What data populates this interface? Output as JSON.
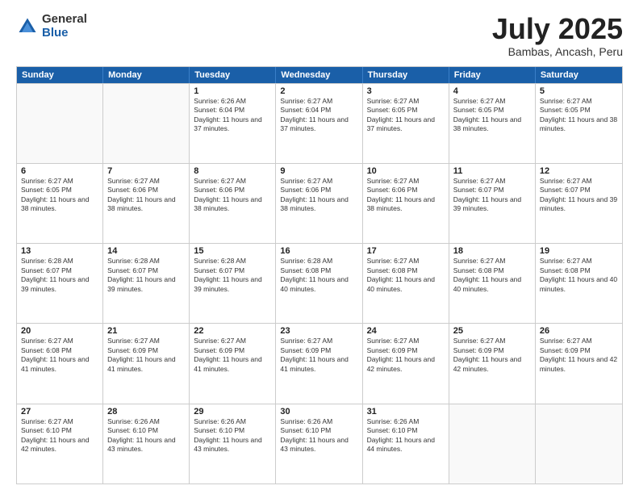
{
  "logo": {
    "general": "General",
    "blue": "Blue"
  },
  "title": "July 2025",
  "subtitle": "Bambas, Ancash, Peru",
  "days": [
    "Sunday",
    "Monday",
    "Tuesday",
    "Wednesday",
    "Thursday",
    "Friday",
    "Saturday"
  ],
  "weeks": [
    [
      {
        "day": "",
        "content": ""
      },
      {
        "day": "",
        "content": ""
      },
      {
        "day": "1",
        "content": "Sunrise: 6:26 AM\nSunset: 6:04 PM\nDaylight: 11 hours and 37 minutes."
      },
      {
        "day": "2",
        "content": "Sunrise: 6:27 AM\nSunset: 6:04 PM\nDaylight: 11 hours and 37 minutes."
      },
      {
        "day": "3",
        "content": "Sunrise: 6:27 AM\nSunset: 6:05 PM\nDaylight: 11 hours and 37 minutes."
      },
      {
        "day": "4",
        "content": "Sunrise: 6:27 AM\nSunset: 6:05 PM\nDaylight: 11 hours and 38 minutes."
      },
      {
        "day": "5",
        "content": "Sunrise: 6:27 AM\nSunset: 6:05 PM\nDaylight: 11 hours and 38 minutes."
      }
    ],
    [
      {
        "day": "6",
        "content": "Sunrise: 6:27 AM\nSunset: 6:05 PM\nDaylight: 11 hours and 38 minutes."
      },
      {
        "day": "7",
        "content": "Sunrise: 6:27 AM\nSunset: 6:06 PM\nDaylight: 11 hours and 38 minutes."
      },
      {
        "day": "8",
        "content": "Sunrise: 6:27 AM\nSunset: 6:06 PM\nDaylight: 11 hours and 38 minutes."
      },
      {
        "day": "9",
        "content": "Sunrise: 6:27 AM\nSunset: 6:06 PM\nDaylight: 11 hours and 38 minutes."
      },
      {
        "day": "10",
        "content": "Sunrise: 6:27 AM\nSunset: 6:06 PM\nDaylight: 11 hours and 38 minutes."
      },
      {
        "day": "11",
        "content": "Sunrise: 6:27 AM\nSunset: 6:07 PM\nDaylight: 11 hours and 39 minutes."
      },
      {
        "day": "12",
        "content": "Sunrise: 6:27 AM\nSunset: 6:07 PM\nDaylight: 11 hours and 39 minutes."
      }
    ],
    [
      {
        "day": "13",
        "content": "Sunrise: 6:28 AM\nSunset: 6:07 PM\nDaylight: 11 hours and 39 minutes."
      },
      {
        "day": "14",
        "content": "Sunrise: 6:28 AM\nSunset: 6:07 PM\nDaylight: 11 hours and 39 minutes."
      },
      {
        "day": "15",
        "content": "Sunrise: 6:28 AM\nSunset: 6:07 PM\nDaylight: 11 hours and 39 minutes."
      },
      {
        "day": "16",
        "content": "Sunrise: 6:28 AM\nSunset: 6:08 PM\nDaylight: 11 hours and 40 minutes."
      },
      {
        "day": "17",
        "content": "Sunrise: 6:27 AM\nSunset: 6:08 PM\nDaylight: 11 hours and 40 minutes."
      },
      {
        "day": "18",
        "content": "Sunrise: 6:27 AM\nSunset: 6:08 PM\nDaylight: 11 hours and 40 minutes."
      },
      {
        "day": "19",
        "content": "Sunrise: 6:27 AM\nSunset: 6:08 PM\nDaylight: 11 hours and 40 minutes."
      }
    ],
    [
      {
        "day": "20",
        "content": "Sunrise: 6:27 AM\nSunset: 6:08 PM\nDaylight: 11 hours and 41 minutes."
      },
      {
        "day": "21",
        "content": "Sunrise: 6:27 AM\nSunset: 6:09 PM\nDaylight: 11 hours and 41 minutes."
      },
      {
        "day": "22",
        "content": "Sunrise: 6:27 AM\nSunset: 6:09 PM\nDaylight: 11 hours and 41 minutes."
      },
      {
        "day": "23",
        "content": "Sunrise: 6:27 AM\nSunset: 6:09 PM\nDaylight: 11 hours and 41 minutes."
      },
      {
        "day": "24",
        "content": "Sunrise: 6:27 AM\nSunset: 6:09 PM\nDaylight: 11 hours and 42 minutes."
      },
      {
        "day": "25",
        "content": "Sunrise: 6:27 AM\nSunset: 6:09 PM\nDaylight: 11 hours and 42 minutes."
      },
      {
        "day": "26",
        "content": "Sunrise: 6:27 AM\nSunset: 6:09 PM\nDaylight: 11 hours and 42 minutes."
      }
    ],
    [
      {
        "day": "27",
        "content": "Sunrise: 6:27 AM\nSunset: 6:10 PM\nDaylight: 11 hours and 42 minutes."
      },
      {
        "day": "28",
        "content": "Sunrise: 6:26 AM\nSunset: 6:10 PM\nDaylight: 11 hours and 43 minutes."
      },
      {
        "day": "29",
        "content": "Sunrise: 6:26 AM\nSunset: 6:10 PM\nDaylight: 11 hours and 43 minutes."
      },
      {
        "day": "30",
        "content": "Sunrise: 6:26 AM\nSunset: 6:10 PM\nDaylight: 11 hours and 43 minutes."
      },
      {
        "day": "31",
        "content": "Sunrise: 6:26 AM\nSunset: 6:10 PM\nDaylight: 11 hours and 44 minutes."
      },
      {
        "day": "",
        "content": ""
      },
      {
        "day": "",
        "content": ""
      }
    ]
  ]
}
